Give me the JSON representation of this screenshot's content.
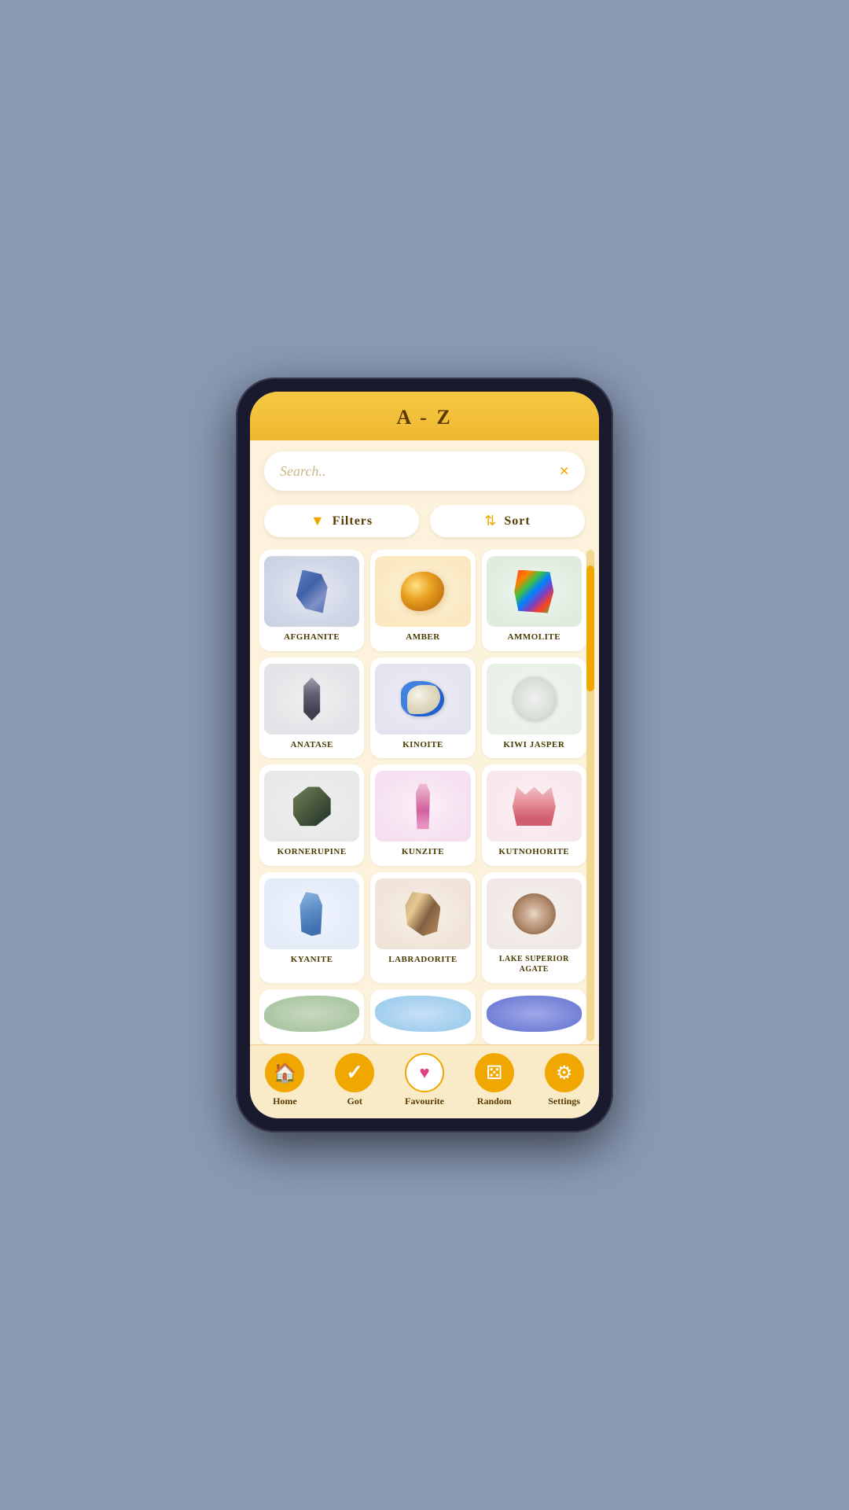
{
  "header": {
    "title": "A - Z"
  },
  "search": {
    "placeholder": "Search..",
    "clear_label": "×"
  },
  "toolbar": {
    "filters_label": "Filters",
    "sort_label": "Sort"
  },
  "minerals": [
    {
      "id": "afghanite",
      "name": "Afghanite",
      "color_class": "mineral-afghanite"
    },
    {
      "id": "amber",
      "name": "Amber",
      "color_class": "mineral-amber"
    },
    {
      "id": "ammolite",
      "name": "Ammolite",
      "color_class": "mineral-ammolite"
    },
    {
      "id": "anatase",
      "name": "Anatase",
      "color_class": "mineral-anatase"
    },
    {
      "id": "kinoite",
      "name": "Kinoite",
      "color_class": "mineral-kinoite"
    },
    {
      "id": "kiwi-jasper",
      "name": "Kiwi Jasper",
      "color_class": "mineral-kiwi-jasper"
    },
    {
      "id": "kornerupine",
      "name": "Kornerupine",
      "color_class": "mineral-kornerupine"
    },
    {
      "id": "kunzite",
      "name": "Kunzite",
      "color_class": "mineral-kunzite"
    },
    {
      "id": "kutnohorite",
      "name": "Kutnohorite",
      "color_class": "mineral-kutnohorite"
    },
    {
      "id": "kyanite",
      "name": "Kyanite",
      "color_class": "mineral-kyanite"
    },
    {
      "id": "labradorite",
      "name": "Labradorite",
      "color_class": "mineral-labradorite"
    },
    {
      "id": "lake-superior-agate",
      "name": "Lake Superior Agate",
      "color_class": "mineral-lake-superior"
    },
    {
      "id": "partial-1",
      "name": "",
      "color_class": "mineral-partial-1"
    },
    {
      "id": "partial-2",
      "name": "",
      "color_class": "mineral-partial-2"
    },
    {
      "id": "partial-3",
      "name": "",
      "color_class": "mineral-partial-3"
    }
  ],
  "nav": {
    "items": [
      {
        "id": "home",
        "label": "Home",
        "icon": "🏠"
      },
      {
        "id": "got",
        "label": "Got",
        "icon": "✓"
      },
      {
        "id": "favourite",
        "label": "Favourite",
        "icon": "♥"
      },
      {
        "id": "random",
        "label": "Random",
        "icon": "⚄"
      },
      {
        "id": "settings",
        "label": "Settings",
        "icon": "⚙"
      }
    ]
  },
  "colors": {
    "accent": "#f0a800",
    "background": "#fdf3dc",
    "header_bg": "#f5c842",
    "text_dark": "#5a3a00",
    "nav_bg": "#faebc8"
  }
}
